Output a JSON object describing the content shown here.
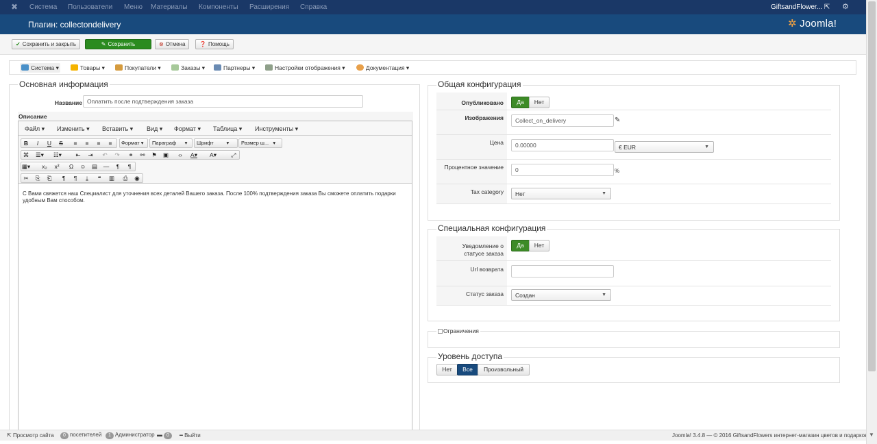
{
  "topnav": {
    "items": [
      "Система",
      "Пользователи",
      "Меню",
      "Материалы",
      "Компоненты",
      "Расширения",
      "Справка"
    ],
    "site_name": "GiftsandFlower..."
  },
  "header": {
    "title": "Плагин: collectondelivery",
    "logo_text": "Joomla!"
  },
  "toolbar": {
    "save_close": "Сохранить и закрыть",
    "save": "Сохранить",
    "cancel": "Отмена",
    "help": "Помощь"
  },
  "subnav": [
    "Система",
    "Товары",
    "Покупатели",
    "Заказы",
    "Партнеры",
    "Настройки отображения",
    "Документация"
  ],
  "main_info": {
    "legend": "Основная информация",
    "name_label": "Название",
    "name_value": "Оплатить после подтверждения заказа",
    "description_label": "Описание",
    "editor_menu": [
      "Файл",
      "Изменить",
      "Вставить",
      "Вид",
      "Формат",
      "Таблица",
      "Инструменты"
    ],
    "editor_selects": [
      "Формат",
      "Параграф",
      "Шрифт",
      "Размер ш..."
    ],
    "content": "С Вами свяжется наш Специалист для уточнения всех деталей Вашего заказа. После 100% подтверждения заказа Вы сможете оплатить подарки удобным Вам способом."
  },
  "general": {
    "legend": "Общая конфигурация",
    "published_label": "Опубликовано",
    "yes": "Да",
    "no": "Нет",
    "images_label": "Изображения",
    "images_value": "Collect_on_delivery",
    "price_label": "Цена",
    "price_value": "0.00000",
    "currency": "€ EUR",
    "percent_label": "Процентное значение",
    "percent_value": "0",
    "percent_sign": "%",
    "tax_label": "Tax category",
    "tax_value": "Нет"
  },
  "special": {
    "legend": "Специальная конфигурация",
    "notify_label_1": "Уведомление о",
    "notify_label_2": "статусе заказа",
    "yes": "Да",
    "no": "Нет",
    "url_label": "Url возврата",
    "url_value": "",
    "status_label": "Статус заказа",
    "status_value": "Создан"
  },
  "restrictions": {
    "legend": "Ограничения"
  },
  "access": {
    "legend": "Уровень доступа",
    "options": [
      "Нет",
      "Все",
      "Произвольный"
    ],
    "selected": "Все"
  },
  "footer": {
    "view_site": "Просмотр сайта",
    "visitors_count": "0",
    "visitors": "посетителей",
    "admins_count": "1",
    "admins": "Администратор",
    "messages_count": "0",
    "logout": "Выйти",
    "copyright": "Joomla! 3.4.8 — © 2016 GiftsandFlowers интернет-магазин цветов и подарков"
  }
}
